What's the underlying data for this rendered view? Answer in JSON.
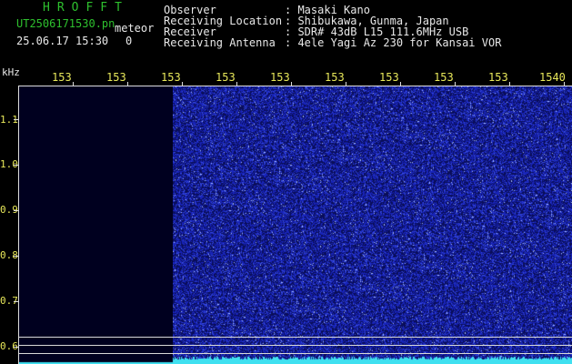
{
  "header": {
    "app_title": "HROFFT",
    "file_name": "UT2506171530.pn",
    "meteor_label": "meteor",
    "timestamp": "25.06.17 15:30",
    "meteor_count": "0"
  },
  "info": [
    {
      "label": "Observer",
      "value": ": Masaki Kano"
    },
    {
      "label": "Receiving Location",
      "value": ": Shibukawa, Gunma, Japan"
    },
    {
      "label": "Receiver",
      "value": ": SDR# 43dB L15 111.6MHz USB"
    },
    {
      "label": "Receiving Antenna",
      "value": ": 4ele Yagi Az 230 for Kansai VOR"
    }
  ],
  "axes": {
    "y_unit": "kHz",
    "x_ticks": [
      "153",
      "153",
      "153",
      "153",
      "153",
      "153",
      "153",
      "153",
      "153",
      "1540"
    ],
    "y_ticks": [
      "1.1",
      "1.0",
      "0.9",
      "0.8",
      "0.7",
      "0.6"
    ]
  },
  "colors": {
    "background": "#000000",
    "spectrogram_active": "#141e9e",
    "trace": "#40e0f0",
    "text_green": "#2ec02e",
    "text_yellow": "#e8e85a"
  }
}
